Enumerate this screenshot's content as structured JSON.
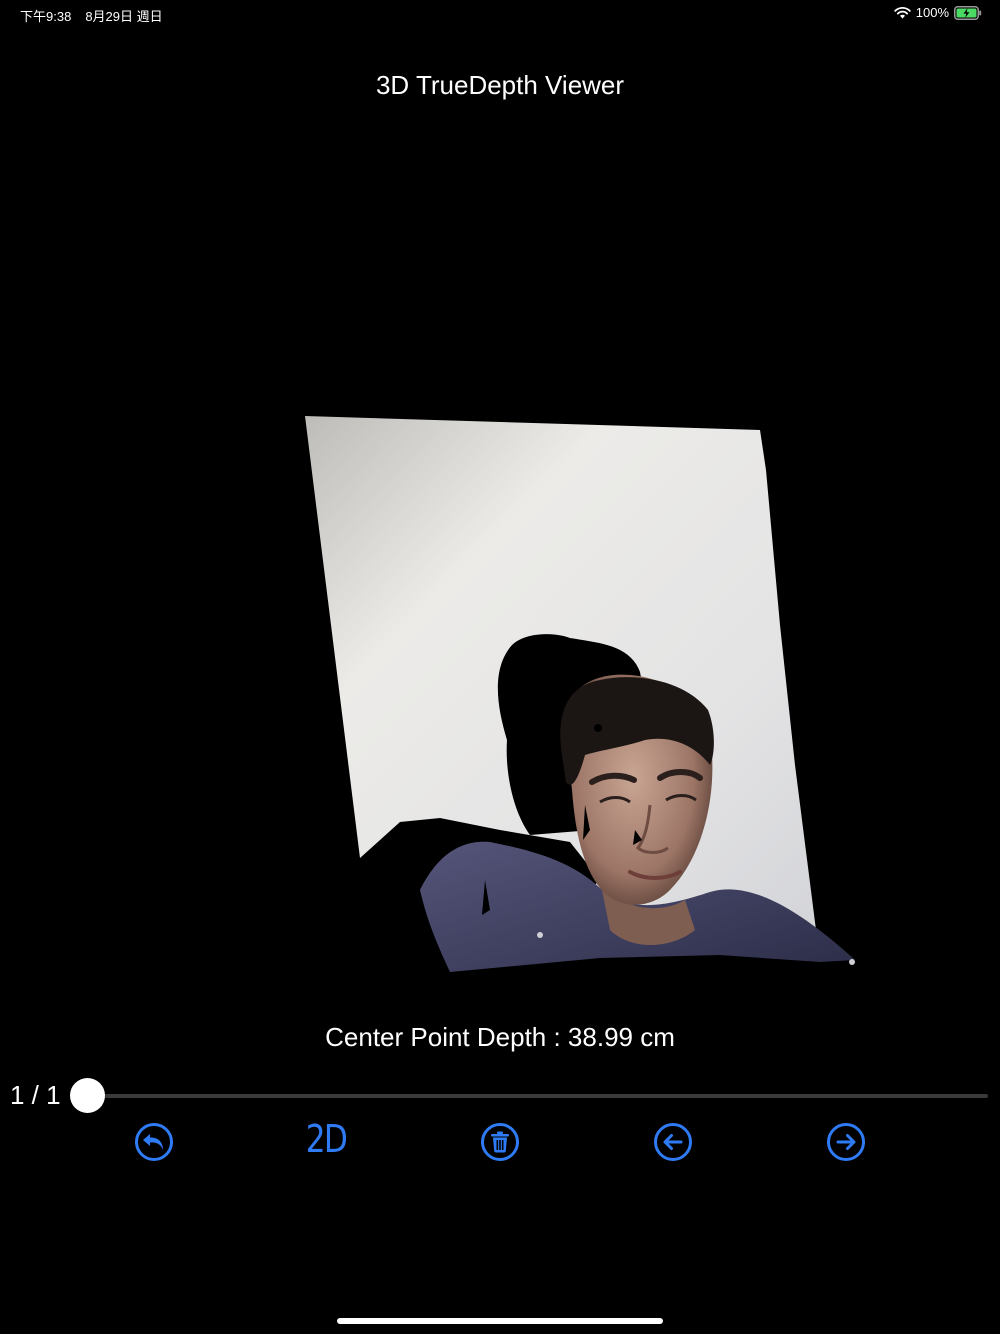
{
  "status_bar": {
    "time": "下午9:38",
    "date": "8月29日 週日",
    "battery_percent": "100%",
    "battery_level": 1.0
  },
  "app": {
    "title": "3D TrueDepth Viewer"
  },
  "viewer": {
    "depth_label": "Center Point Depth : 38.99 cm"
  },
  "pager": {
    "counter": "1 / 1",
    "slider_fraction": 0.0
  },
  "toolbar": {
    "btn_2d_label": "2D",
    "accent_color": "#2f7bf5",
    "icons": [
      "undo-icon",
      "2d-toggle",
      "trash-icon",
      "arrow-left-icon",
      "arrow-right-icon"
    ]
  }
}
